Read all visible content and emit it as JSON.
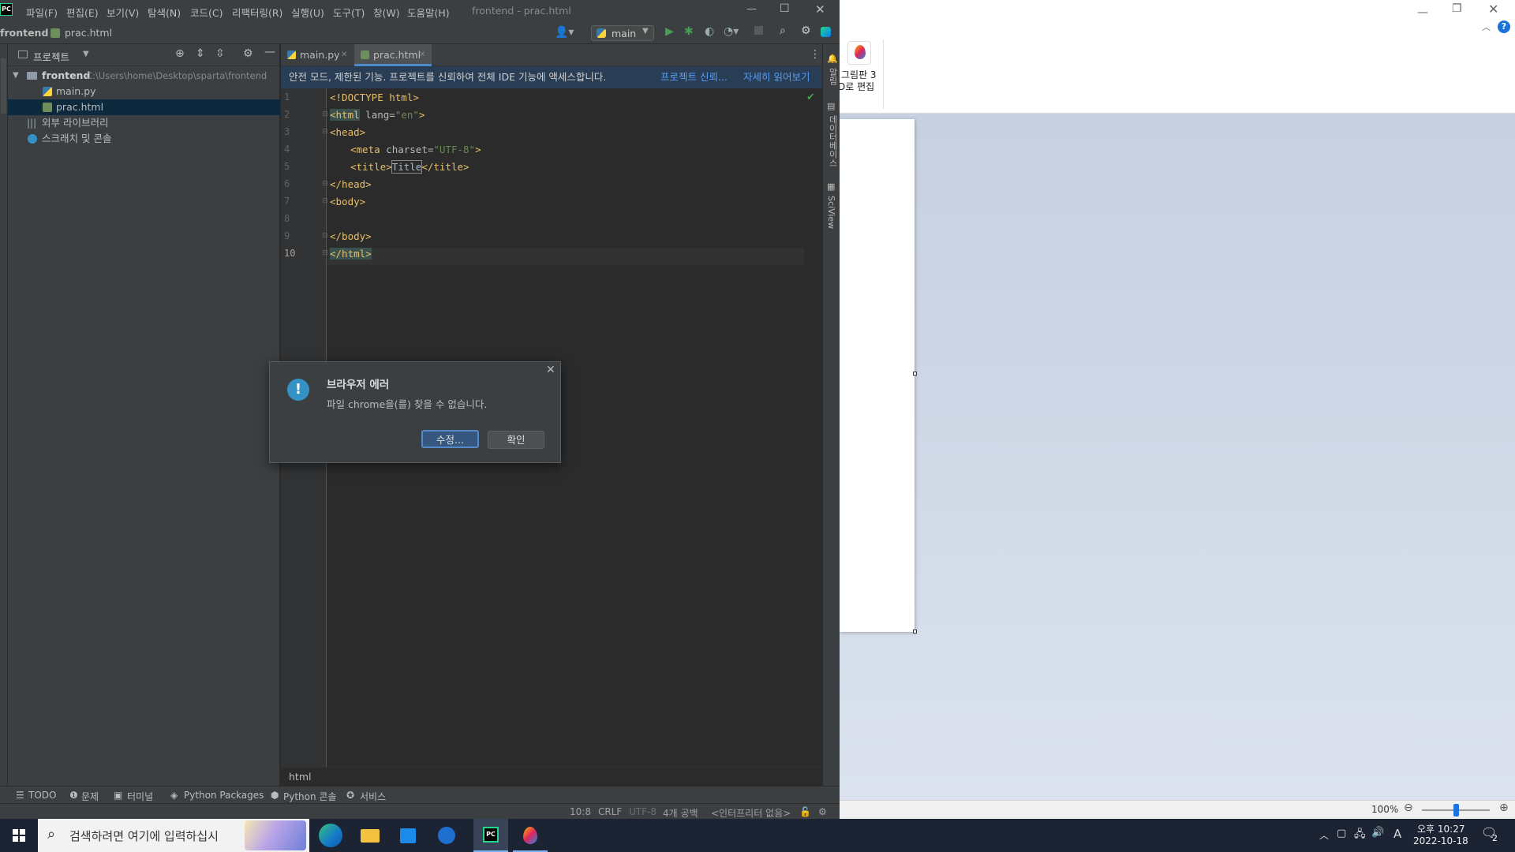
{
  "ide": {
    "title": "frontend - prac.html",
    "menu": [
      "파일(F)",
      "편집(E)",
      "보기(V)",
      "탐색(N)",
      "코드(C)",
      "리팩터링(R)",
      "실행(U)",
      "도구(T)",
      "창(W)",
      "도움말(H)"
    ],
    "nav": {
      "project": "frontend",
      "file": "prac.html",
      "run_config": "main"
    },
    "project_panel": {
      "title": "프로젝트",
      "root": "frontend",
      "root_path": "C:\\Users\\home\\Desktop\\sparta\\frontend",
      "files": [
        "main.py",
        "prac.html"
      ],
      "external_libs": "외부 라이브러리",
      "scratches": "스크래치 및 콘솔"
    },
    "tabs": [
      "main.py",
      "prac.html"
    ],
    "banner": {
      "text": "안전 모드, 제한된 기능. 프로젝트를 신뢰하여 전체 IDE 기능에 액세스합니다.",
      "trust_link": "프로젝트 신뢰...",
      "more_link": "자세히 읽어보기"
    },
    "code": {
      "line_numbers": [
        "1",
        "2",
        "3",
        "4",
        "5",
        "6",
        "7",
        "8",
        "9",
        "10"
      ],
      "l1": "<!DOCTYPE html>",
      "l2_tag": "<html",
      "l2_attr": " lang=",
      "l2_val": "\"en\"",
      "l2_close": ">",
      "l3": "<head>",
      "l4_tag": "<meta",
      "l4_attr": " charset=",
      "l4_val": "\"UTF-8\"",
      "l4_close": ">",
      "l5_open": "<title>",
      "l5_text": "Title",
      "l5_close": "</title>",
      "l6": "</head>",
      "l7": "<body>",
      "l9": "</body>",
      "l10": "</html>"
    },
    "breadcrumb_bottom": "html",
    "right_stripe": [
      "알림",
      "데이터베이스",
      "SciView"
    ],
    "tool_windows": [
      "TODO",
      "문제",
      "터미널",
      "Python Packages",
      "Python 콘솔",
      "서비스"
    ],
    "status": {
      "position": "10:8",
      "line_sep": "CRLF",
      "encoding": "UTF-8",
      "indent": "4개 공백",
      "interpreter": "<인터프리터 없음>"
    }
  },
  "dialog": {
    "title": "브라우저 에러",
    "message": "파일 chrome을(를) 찾을 수 없습니다.",
    "edit_button": "수정...",
    "ok_button": "확인"
  },
  "paint": {
    "ribbon_label_line1": "그림판 3",
    "ribbon_label_line2": "D로 편집",
    "zoom": "100%",
    "zoom_level": 0.5
  },
  "taskbar": {
    "search_placeholder": "검색하려면 여기에 입력하십시",
    "time_line1": "오후 10:27",
    "time_line2": "2022-10-18",
    "ime": "A",
    "notification_count": "2"
  },
  "colors": {
    "ide_bg": "#2b2b2b",
    "panel_bg": "#3c3f41",
    "selection": "#0d293e",
    "accent": "#4a88c7",
    "run_green": "#499c54"
  }
}
